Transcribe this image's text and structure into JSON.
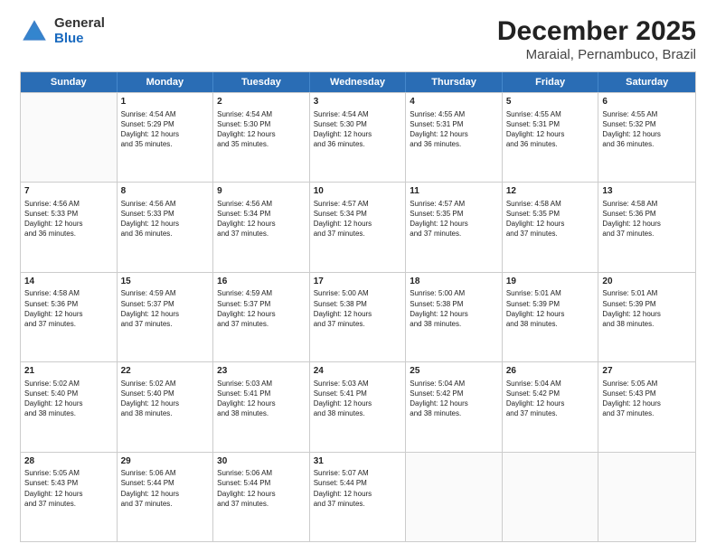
{
  "logo": {
    "general": "General",
    "blue": "Blue"
  },
  "title": "December 2025",
  "subtitle": "Maraial, Pernambuco, Brazil",
  "header_days": [
    "Sunday",
    "Monday",
    "Tuesday",
    "Wednesday",
    "Thursday",
    "Friday",
    "Saturday"
  ],
  "weeks": [
    [
      {
        "day": "",
        "info": ""
      },
      {
        "day": "1",
        "info": "Sunrise: 4:54 AM\nSunset: 5:29 PM\nDaylight: 12 hours\nand 35 minutes."
      },
      {
        "day": "2",
        "info": "Sunrise: 4:54 AM\nSunset: 5:30 PM\nDaylight: 12 hours\nand 35 minutes."
      },
      {
        "day": "3",
        "info": "Sunrise: 4:54 AM\nSunset: 5:30 PM\nDaylight: 12 hours\nand 36 minutes."
      },
      {
        "day": "4",
        "info": "Sunrise: 4:55 AM\nSunset: 5:31 PM\nDaylight: 12 hours\nand 36 minutes."
      },
      {
        "day": "5",
        "info": "Sunrise: 4:55 AM\nSunset: 5:31 PM\nDaylight: 12 hours\nand 36 minutes."
      },
      {
        "day": "6",
        "info": "Sunrise: 4:55 AM\nSunset: 5:32 PM\nDaylight: 12 hours\nand 36 minutes."
      }
    ],
    [
      {
        "day": "7",
        "info": "Sunrise: 4:56 AM\nSunset: 5:33 PM\nDaylight: 12 hours\nand 36 minutes."
      },
      {
        "day": "8",
        "info": "Sunrise: 4:56 AM\nSunset: 5:33 PM\nDaylight: 12 hours\nand 36 minutes."
      },
      {
        "day": "9",
        "info": "Sunrise: 4:56 AM\nSunset: 5:34 PM\nDaylight: 12 hours\nand 37 minutes."
      },
      {
        "day": "10",
        "info": "Sunrise: 4:57 AM\nSunset: 5:34 PM\nDaylight: 12 hours\nand 37 minutes."
      },
      {
        "day": "11",
        "info": "Sunrise: 4:57 AM\nSunset: 5:35 PM\nDaylight: 12 hours\nand 37 minutes."
      },
      {
        "day": "12",
        "info": "Sunrise: 4:58 AM\nSunset: 5:35 PM\nDaylight: 12 hours\nand 37 minutes."
      },
      {
        "day": "13",
        "info": "Sunrise: 4:58 AM\nSunset: 5:36 PM\nDaylight: 12 hours\nand 37 minutes."
      }
    ],
    [
      {
        "day": "14",
        "info": "Sunrise: 4:58 AM\nSunset: 5:36 PM\nDaylight: 12 hours\nand 37 minutes."
      },
      {
        "day": "15",
        "info": "Sunrise: 4:59 AM\nSunset: 5:37 PM\nDaylight: 12 hours\nand 37 minutes."
      },
      {
        "day": "16",
        "info": "Sunrise: 4:59 AM\nSunset: 5:37 PM\nDaylight: 12 hours\nand 37 minutes."
      },
      {
        "day": "17",
        "info": "Sunrise: 5:00 AM\nSunset: 5:38 PM\nDaylight: 12 hours\nand 37 minutes."
      },
      {
        "day": "18",
        "info": "Sunrise: 5:00 AM\nSunset: 5:38 PM\nDaylight: 12 hours\nand 38 minutes."
      },
      {
        "day": "19",
        "info": "Sunrise: 5:01 AM\nSunset: 5:39 PM\nDaylight: 12 hours\nand 38 minutes."
      },
      {
        "day": "20",
        "info": "Sunrise: 5:01 AM\nSunset: 5:39 PM\nDaylight: 12 hours\nand 38 minutes."
      }
    ],
    [
      {
        "day": "21",
        "info": "Sunrise: 5:02 AM\nSunset: 5:40 PM\nDaylight: 12 hours\nand 38 minutes."
      },
      {
        "day": "22",
        "info": "Sunrise: 5:02 AM\nSunset: 5:40 PM\nDaylight: 12 hours\nand 38 minutes."
      },
      {
        "day": "23",
        "info": "Sunrise: 5:03 AM\nSunset: 5:41 PM\nDaylight: 12 hours\nand 38 minutes."
      },
      {
        "day": "24",
        "info": "Sunrise: 5:03 AM\nSunset: 5:41 PM\nDaylight: 12 hours\nand 38 minutes."
      },
      {
        "day": "25",
        "info": "Sunrise: 5:04 AM\nSunset: 5:42 PM\nDaylight: 12 hours\nand 38 minutes."
      },
      {
        "day": "26",
        "info": "Sunrise: 5:04 AM\nSunset: 5:42 PM\nDaylight: 12 hours\nand 37 minutes."
      },
      {
        "day": "27",
        "info": "Sunrise: 5:05 AM\nSunset: 5:43 PM\nDaylight: 12 hours\nand 37 minutes."
      }
    ],
    [
      {
        "day": "28",
        "info": "Sunrise: 5:05 AM\nSunset: 5:43 PM\nDaylight: 12 hours\nand 37 minutes."
      },
      {
        "day": "29",
        "info": "Sunrise: 5:06 AM\nSunset: 5:44 PM\nDaylight: 12 hours\nand 37 minutes."
      },
      {
        "day": "30",
        "info": "Sunrise: 5:06 AM\nSunset: 5:44 PM\nDaylight: 12 hours\nand 37 minutes."
      },
      {
        "day": "31",
        "info": "Sunrise: 5:07 AM\nSunset: 5:44 PM\nDaylight: 12 hours\nand 37 minutes."
      },
      {
        "day": "",
        "info": ""
      },
      {
        "day": "",
        "info": ""
      },
      {
        "day": "",
        "info": ""
      }
    ]
  ]
}
